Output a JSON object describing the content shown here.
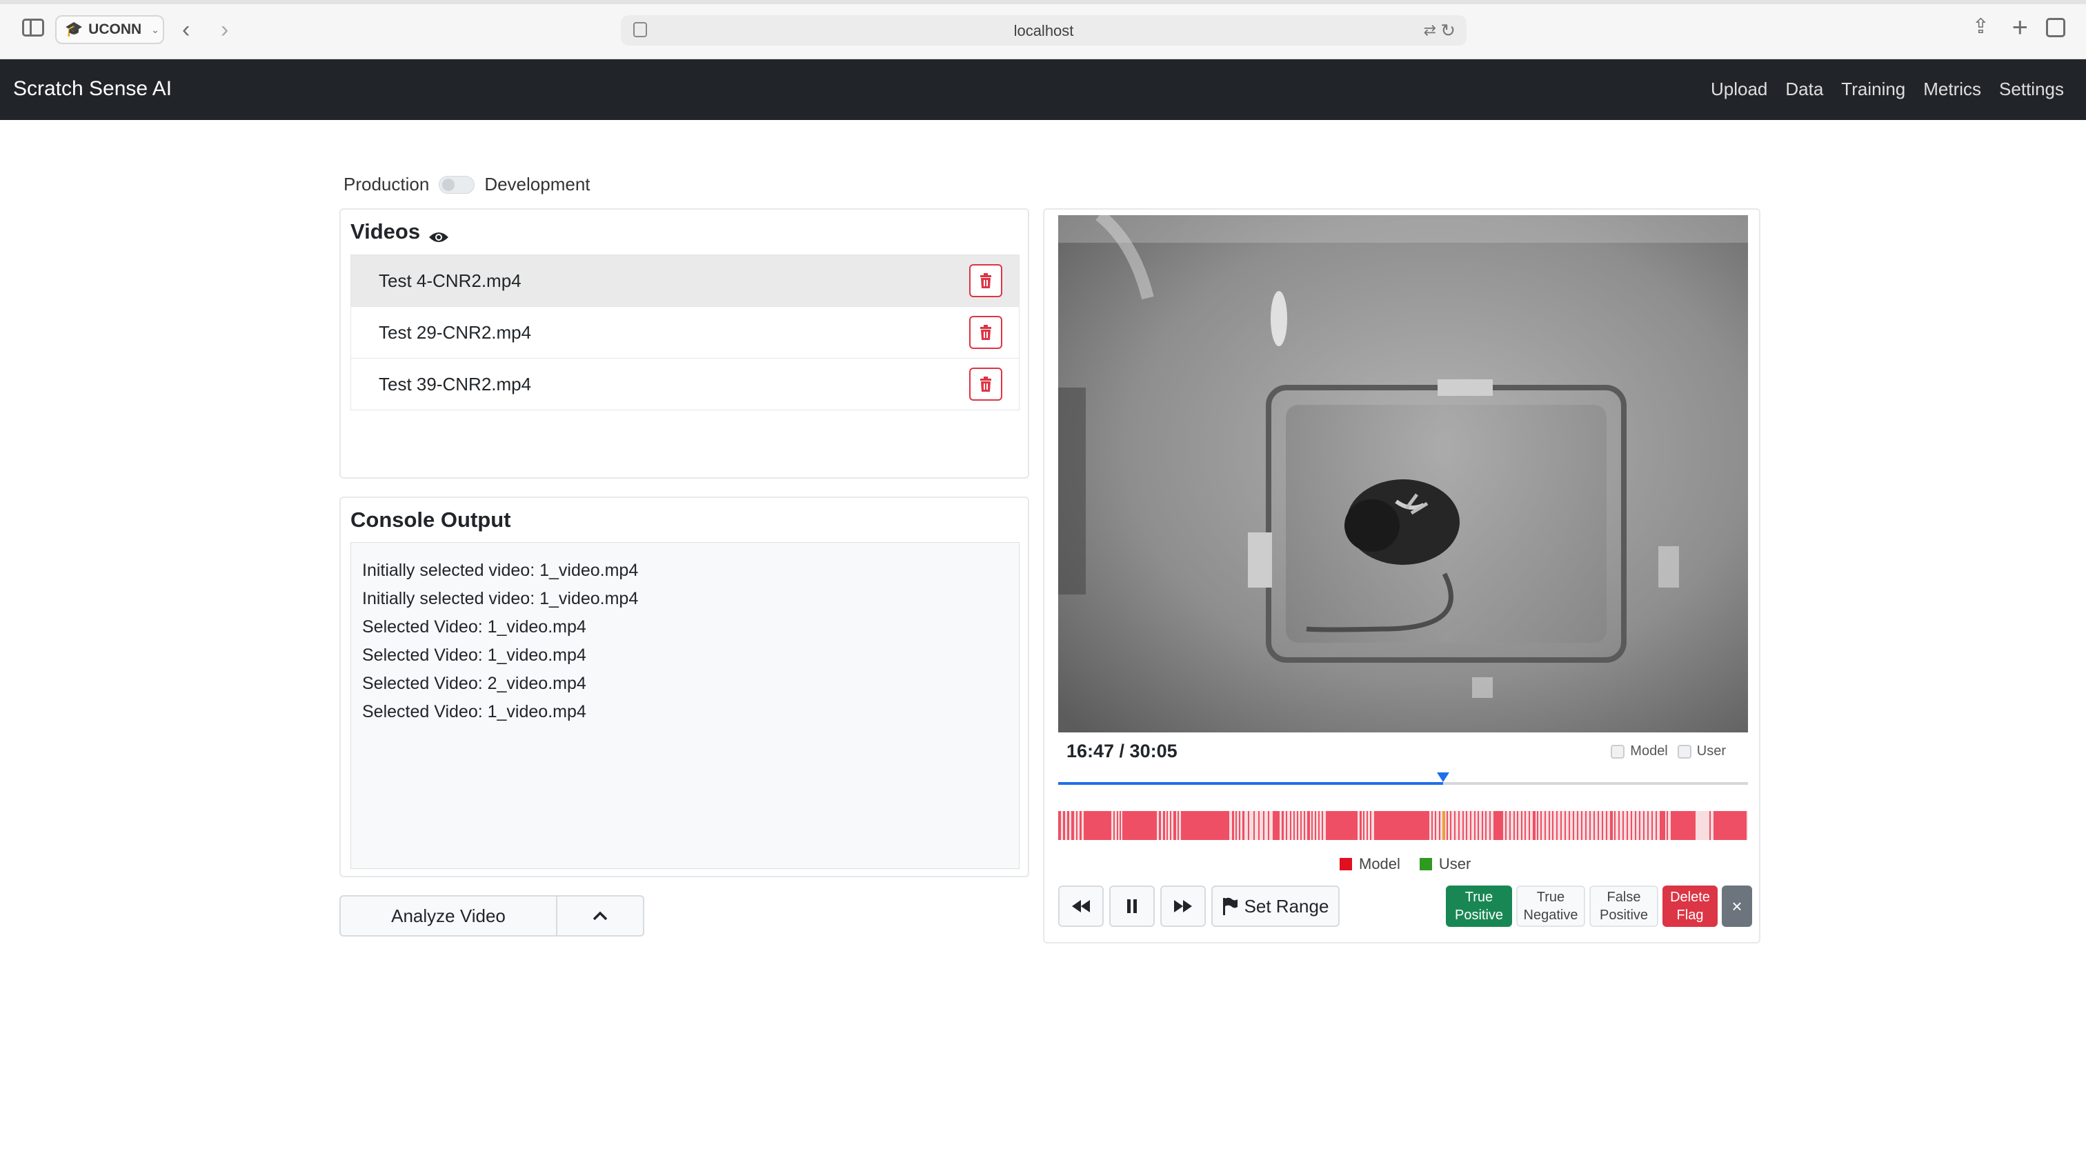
{
  "browser": {
    "profile_label": "UCONN",
    "url": "localhost"
  },
  "navbar": {
    "brand": "Scratch Sense AI",
    "links": [
      "Upload",
      "Data",
      "Training",
      "Metrics",
      "Settings"
    ]
  },
  "mode": {
    "left_label": "Production",
    "right_label": "Development",
    "selected": "Production"
  },
  "videos": {
    "title": "Videos",
    "items": [
      {
        "name": "Test 4-CNR2.mp4",
        "selected": true
      },
      {
        "name": "Test 29-CNR2.mp4",
        "selected": false
      },
      {
        "name": "Test 39-CNR2.mp4",
        "selected": false
      }
    ]
  },
  "console": {
    "title": "Console Output",
    "lines": [
      "Initially selected video: 1_video.mp4",
      "Initially selected video: 1_video.mp4",
      "Selected Video: 1_video.mp4",
      "Selected Video: 1_video.mp4",
      "Selected Video: 2_video.mp4",
      "Selected Video: 1_video.mp4"
    ]
  },
  "analyze": {
    "label": "Analyze Video"
  },
  "player": {
    "time": "16:47 / 30:05",
    "progress": 0.558,
    "checks": {
      "model_label": "Model",
      "user_label": "User"
    },
    "legend": {
      "model_label": "Model",
      "user_label": "User",
      "model_color": "#e0101f",
      "user_color": "#2e9a1f"
    },
    "timeline_color": "#ef4f64",
    "controls": {
      "set_range_label": "Set Range",
      "true_positive_label": "True\nPositive",
      "true_negative_label": "True\nNegative",
      "false_positive_label": "False\nPositive",
      "delete_flag_label": "Delete\nFlag",
      "close_label": "×"
    }
  }
}
